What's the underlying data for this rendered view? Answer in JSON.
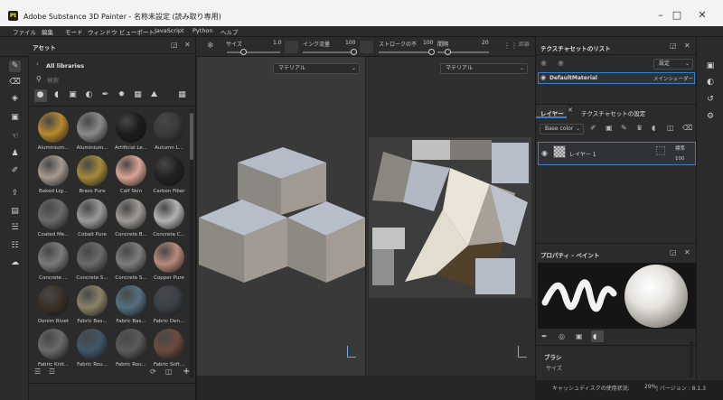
{
  "window": {
    "title": "Adobe Substance 3D Painter - 名称未設定 (読み取り専用)",
    "app_icon": "Pt"
  },
  "menu": [
    "ファイル",
    "編集",
    "モード",
    "ウィンドウ",
    "ビューポート",
    "JavaScript",
    "Python",
    "ヘルプ"
  ],
  "toolbar": {
    "size_label": "サイズ",
    "size_value": "1.0",
    "flow_label": "インク流量",
    "flow_value": "100",
    "stroke_label": "ストロークの不",
    "stroke_value": "100",
    "spacing_label": "間隔",
    "spacing_value": "20",
    "distance_label": "距離"
  },
  "assets": {
    "title": "アセット",
    "library": "All libraries",
    "search_placeholder": "検索",
    "items": [
      {
        "label": "Aluminium...",
        "color": "#b8892e"
      },
      {
        "label": "Aluminium...",
        "color": "#8a8a8a"
      },
      {
        "label": "Artificial Le...",
        "color": "#1c1c1c"
      },
      {
        "label": "Autumn L...",
        "color": "#3a3a3a"
      },
      {
        "label": "Baked Lig...",
        "color": "#a59a8d"
      },
      {
        "label": "Brass Pure",
        "color": "#a58a3a"
      },
      {
        "label": "Calf Skin",
        "color": "#d9a594"
      },
      {
        "label": "Carbon Fiber",
        "color": "#222222"
      },
      {
        "label": "Coated Me...",
        "color": "#6b6b6b"
      },
      {
        "label": "Cobalt Pure",
        "color": "#9a9a9a"
      },
      {
        "label": "Concrete B...",
        "color": "#9f9a94"
      },
      {
        "label": "Concrete C...",
        "color": "#b2b2b2"
      },
      {
        "label": "Concrete ...",
        "color": "#7a7a7a"
      },
      {
        "label": "Concrete S...",
        "color": "#6a6a6a"
      },
      {
        "label": "Concrete S...",
        "color": "#7d7d7d"
      },
      {
        "label": "Copper Pure",
        "color": "#b88b7a"
      },
      {
        "label": "Denim Rivet",
        "color": "#3a3127"
      },
      {
        "label": "Fabric Bas...",
        "color": "#8a8266"
      },
      {
        "label": "Fabric Bas...",
        "color": "#54707f"
      },
      {
        "label": "Fabric Den...",
        "color": "#3b3f44"
      },
      {
        "label": "Fabric Knit...",
        "color": "#6a6a6a"
      },
      {
        "label": "Fabric Rou...",
        "color": "#3f5668"
      },
      {
        "label": "Fabric Rou...",
        "color": "#5a5a5a"
      },
      {
        "label": "Fabric Soft...",
        "color": "#6b4a3e"
      }
    ]
  },
  "viewport": {
    "material_label": "マテリアル"
  },
  "texture_sets": {
    "title": "テクスチャセットのリスト",
    "settings_label": "設定",
    "item_name": "DefaultMaterial",
    "shader": "メインシェーダー"
  },
  "layers": {
    "tab_layers": "レイヤー",
    "tab_settings": "テクスチャセットの設定",
    "channel": "Base color",
    "layer_name": "レイヤー 1",
    "blend_mode": "標準",
    "opacity": "100"
  },
  "properties": {
    "title": "プロパティ - ペイント",
    "section": "ブラシ",
    "size_label": "サイズ"
  },
  "status": {
    "text": "キャッシュディスクの使用状況:",
    "percent": "29%",
    "version": "| バージョン : 8.1.3"
  }
}
